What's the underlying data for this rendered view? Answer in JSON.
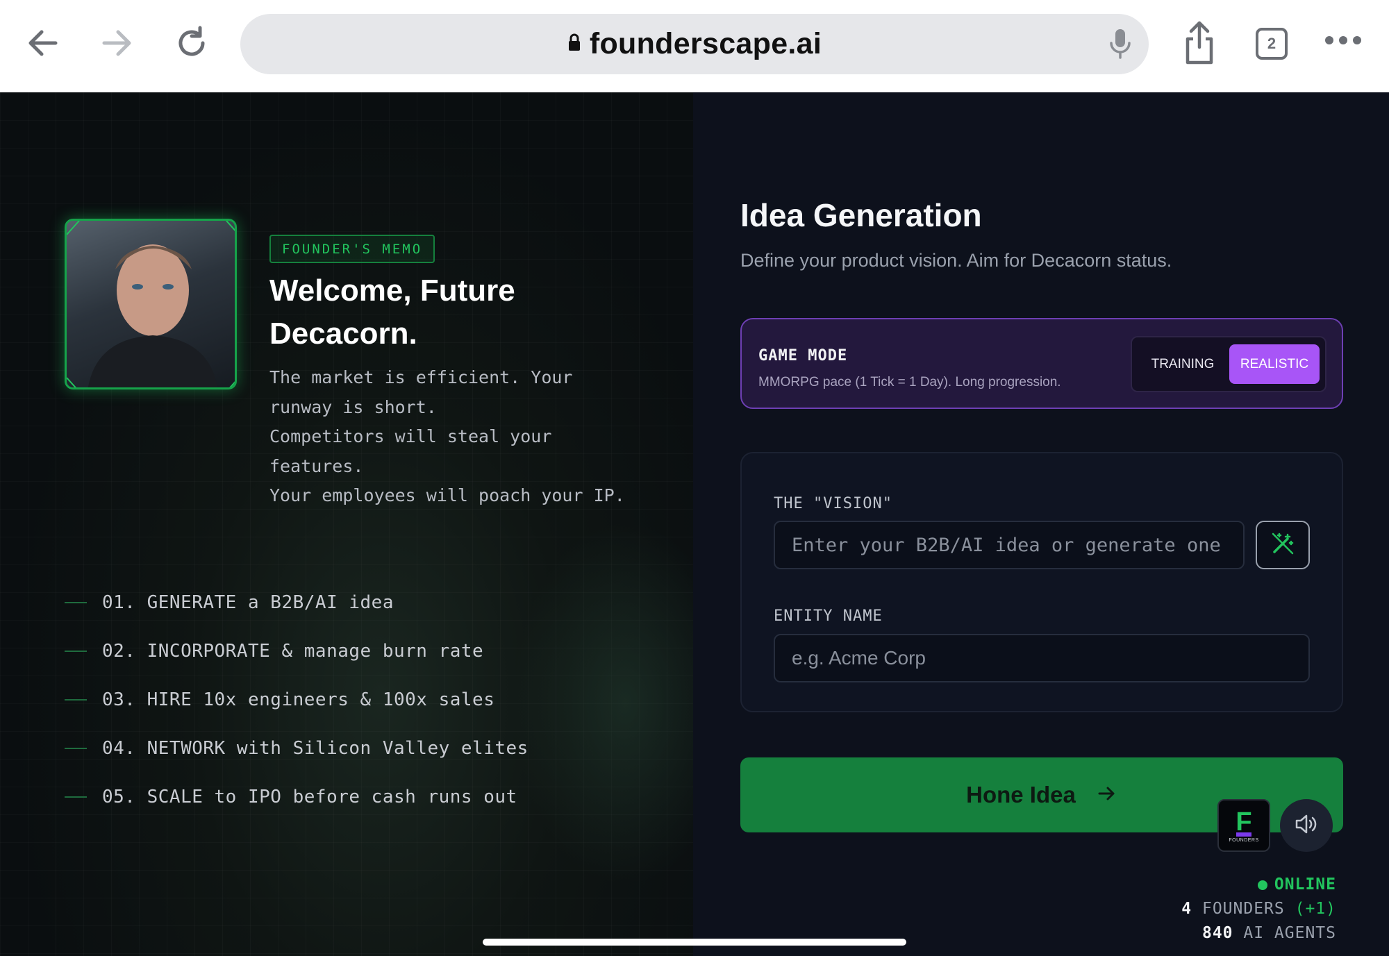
{
  "browser": {
    "url": "founderscape.ai",
    "tab_count": "2",
    "icons": [
      "back-icon",
      "forward-icon",
      "reload-icon",
      "lock-icon",
      "mic-icon",
      "share-icon",
      "tabs-icon",
      "more-icon"
    ]
  },
  "memo": {
    "badge": "FOUNDER'S MEMO",
    "title": "Welcome, Future Decacorn.",
    "lines": [
      "The market is efficient. Your runway is short.",
      "Competitors will steal your features.",
      "Your employees will poach your IP."
    ]
  },
  "steps": [
    "01. GENERATE a B2B/AI idea",
    "02. INCORPORATE & manage burn rate",
    "03. HIRE 10x engineers & 100x sales",
    "04. NETWORK with Silicon Valley elites",
    "05. SCALE to IPO before cash runs out"
  ],
  "idea": {
    "title": "Idea Generation",
    "subtitle": "Define your product vision. Aim for Decacorn status."
  },
  "game_mode": {
    "label": "GAME MODE",
    "description": "MMORPG pace (1 Tick = 1 Day). Long progression.",
    "options": [
      "TRAINING",
      "REALISTIC"
    ],
    "selected": "REALISTIC"
  },
  "form": {
    "vision_label": "THE \"VISION\"",
    "vision_placeholder": "Enter your B2B/AI idea or generate one",
    "vision_value": "",
    "entity_label": "ENTITY NAME",
    "entity_placeholder": "e.g. Acme Corp",
    "entity_value": ""
  },
  "cta": {
    "label": "Hone Idea"
  },
  "logo": {
    "text": "FOUNDERS"
  },
  "status": {
    "online": "ONLINE",
    "founders_count": "4",
    "founders_label": "FOUNDERS",
    "founders_delta": "(+1)",
    "agents_count": "840",
    "agents_label": "AI AGENTS"
  },
  "colors": {
    "accent_green": "#22c55e",
    "accent_purple": "#a855f7",
    "button_green": "#15803d",
    "panel_bg": "#0d111c"
  }
}
